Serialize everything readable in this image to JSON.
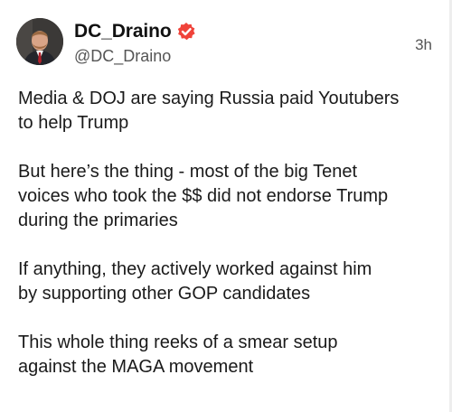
{
  "post": {
    "author": {
      "display_name": "DC_Draino",
      "handle": "@DC_Draino",
      "verified_icon": "verified-badge-icon",
      "verified_color": "#f0433a"
    },
    "timestamp": "3h",
    "paragraphs": [
      {
        "lines": [
          "Media & DOJ are saying Russia paid Youtubers",
          "to help Trump"
        ]
      },
      {
        "lines": [
          "But here’s the thing - most of the big Tenet",
          "voices who took the $$ did not endorse Trump",
          "during the primaries"
        ]
      },
      {
        "lines": [
          "If anything, they actively worked against him",
          "by supporting other GOP candidates"
        ]
      },
      {
        "lines": [
          "This whole thing reeks of a smear setup",
          "against the MAGA movement"
        ]
      }
    ]
  }
}
